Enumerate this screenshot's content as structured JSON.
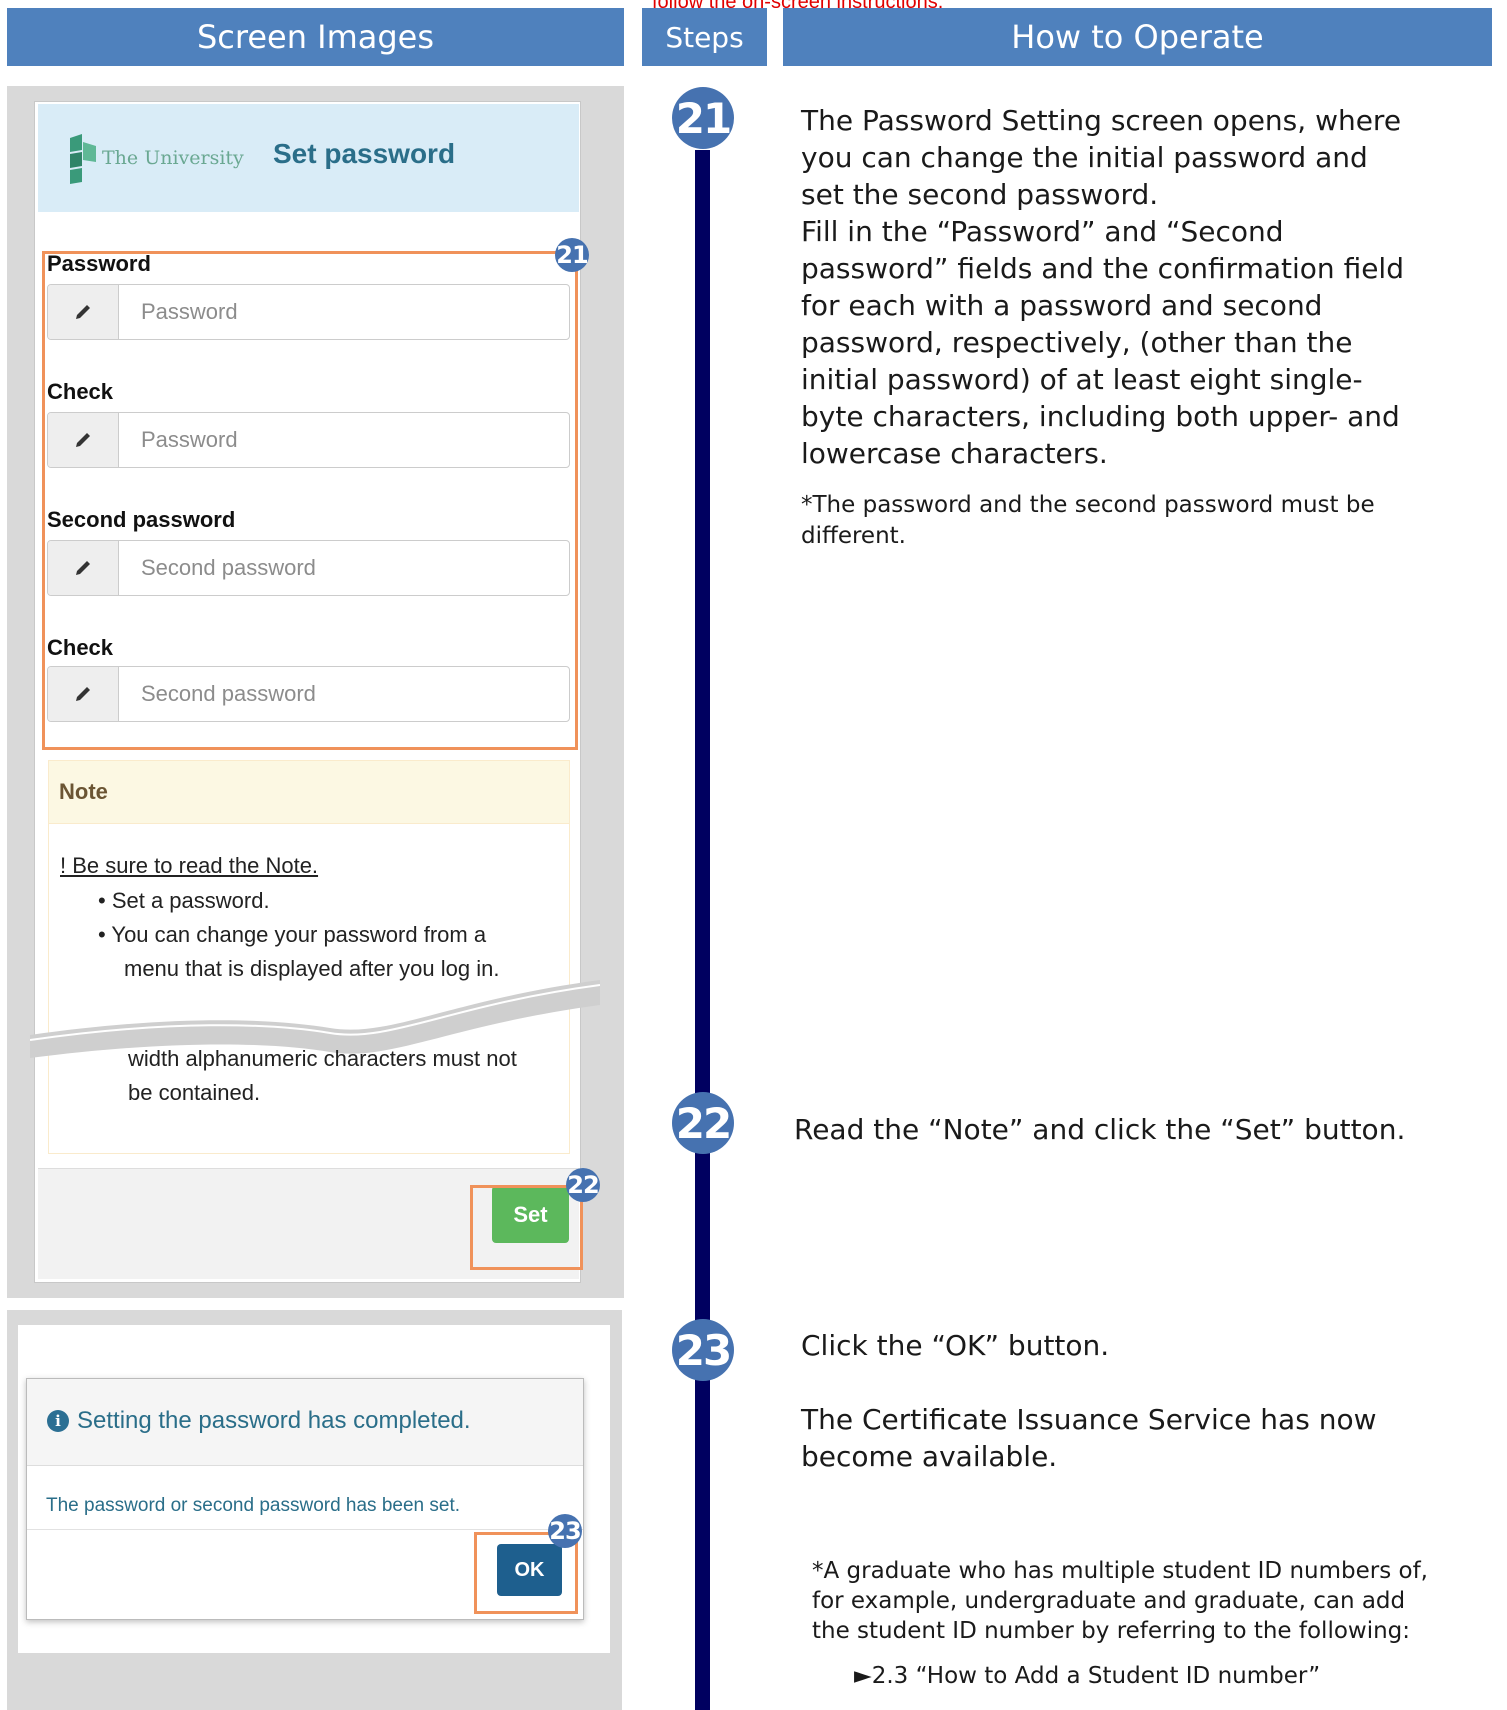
{
  "top_note": "follow the on-screen instructions.",
  "headers": {
    "screen_images": "Screen Images",
    "steps": "Steps",
    "how_to_operate": "How to Operate"
  },
  "app": {
    "logo_text": "The University",
    "page_title": "Set password",
    "fields": [
      {
        "label": "Password",
        "placeholder": "Password"
      },
      {
        "label": "Check",
        "placeholder": "Password"
      },
      {
        "label": "Second password",
        "placeholder": "Second password"
      },
      {
        "label": "Check",
        "placeholder": "Second password"
      }
    ],
    "note": {
      "heading": "Note",
      "warning": "! Be sure to read the Note.",
      "bullets": [
        "Set a password.",
        "You can change your password from a",
        "menu that is displayed after you log in."
      ],
      "tail_lines": [
        "width alphanumeric characters must not",
        "be contained."
      ]
    },
    "set_button": "Set"
  },
  "modal": {
    "title": "Setting the password has completed.",
    "message": "The password or second password has been set.",
    "ok_button": "OK"
  },
  "badges": {
    "b21": "21",
    "b22": "22",
    "b23": "23"
  },
  "steps": {
    "s21": {
      "number": "21",
      "lines": [
        "The Password Setting screen opens, where",
        "you can change the initial password and",
        "set the second password.",
        "Fill in the “Password” and “Second",
        "password” fields and the confirmation field",
        "for each with a password and second",
        "password, respectively, (other than the",
        "initial password) of at least eight single-",
        "byte characters, including both upper- and",
        "lowercase characters."
      ],
      "note_lines": [
        "*The password and the second password must be",
        "different."
      ]
    },
    "s22": {
      "number": "22",
      "text": "Read the “Note” and click the “Set” button."
    },
    "s23": {
      "number": "23",
      "text": "Click the “OK” button.",
      "lines": [
        "The Certificate Issuance Service has now",
        "become available."
      ],
      "note_lines": [
        "*A graduate who has multiple student ID numbers of,",
        "for example, undergraduate and graduate, can add",
        "the student ID number by referring to the following:"
      ],
      "link": "►2.3 “How to Add a Student ID number”"
    }
  },
  "colors": {
    "header_blue": "#4f81bd",
    "badge_blue": "#4672b0",
    "highlight_orange": "#f0925a",
    "timeline_navy": "#000060",
    "set_green": "#5cb85c",
    "ok_blue": "#1e5f8e"
  }
}
